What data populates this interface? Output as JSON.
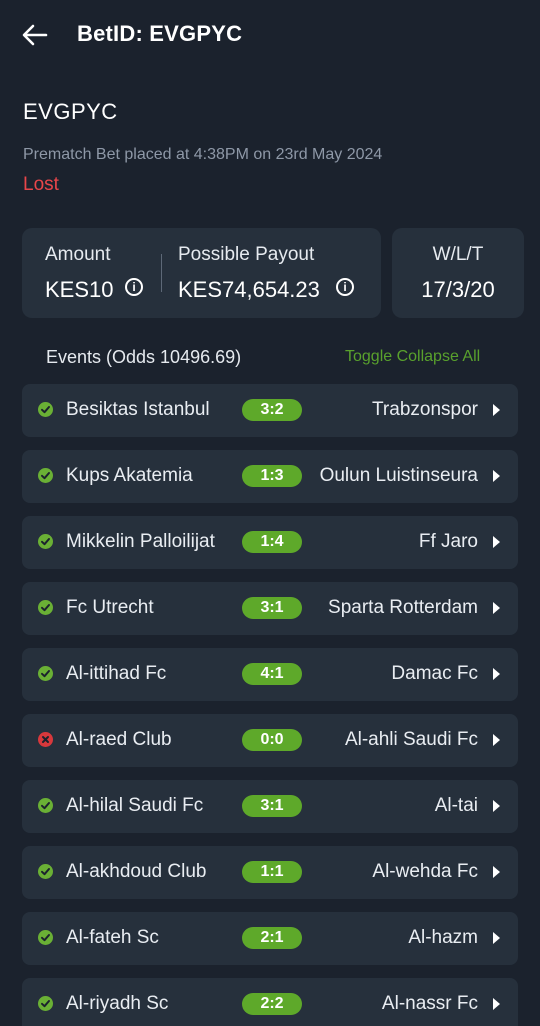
{
  "header": {
    "title": "BetID: EVGPYC"
  },
  "bet": {
    "code": "EVGPYC",
    "placed": "Prematch Bet placed at 4:38PM on 23rd May 2024",
    "status": "Lost"
  },
  "summary": {
    "amount_label": "Amount",
    "amount_value": "KES10",
    "payout_label": "Possible Payout",
    "payout_value": "KES74,654.23",
    "wlt_label": "W/L/T",
    "wlt_value": "17/3/20"
  },
  "events": {
    "header": "Events (Odds 10496.69)",
    "toggle_label": "Toggle Collapse All",
    "items": [
      {
        "status": "win",
        "home": "Besiktas Istanbul",
        "score": "3:2",
        "away": "Trabzonspor"
      },
      {
        "status": "win",
        "home": "Kups Akatemia",
        "score": "1:3",
        "away": "Oulun Luistinseura"
      },
      {
        "status": "win",
        "home": "Mikkelin Palloilijat",
        "score": "1:4",
        "away": "Ff Jaro"
      },
      {
        "status": "win",
        "home": "Fc Utrecht",
        "score": "3:1",
        "away": "Sparta Rotterdam"
      },
      {
        "status": "win",
        "home": "Al-ittihad Fc",
        "score": "4:1",
        "away": "Damac Fc"
      },
      {
        "status": "loss",
        "home": "Al-raed Club",
        "score": "0:0",
        "away": "Al-ahli Saudi Fc"
      },
      {
        "status": "win",
        "home": "Al-hilal Saudi Fc",
        "score": "3:1",
        "away": "Al-tai"
      },
      {
        "status": "win",
        "home": "Al-akhdoud Club",
        "score": "1:1",
        "away": "Al-wehda Fc"
      },
      {
        "status": "win",
        "home": "Al-fateh Sc",
        "score": "2:1",
        "away": "Al-hazm"
      },
      {
        "status": "win",
        "home": "Al-riyadh Sc",
        "score": "2:2",
        "away": "Al-nassr Fc"
      }
    ]
  },
  "colors": {
    "background": "#1b222d",
    "card": "#26303c",
    "accent_green": "#5ea92a",
    "lost_red": "#e8464a"
  },
  "icons": {
    "back": "arrow-left-icon",
    "info": "info-icon",
    "win": "check-circle-icon",
    "loss": "x-circle-icon",
    "expand": "chevron-right-icon"
  }
}
